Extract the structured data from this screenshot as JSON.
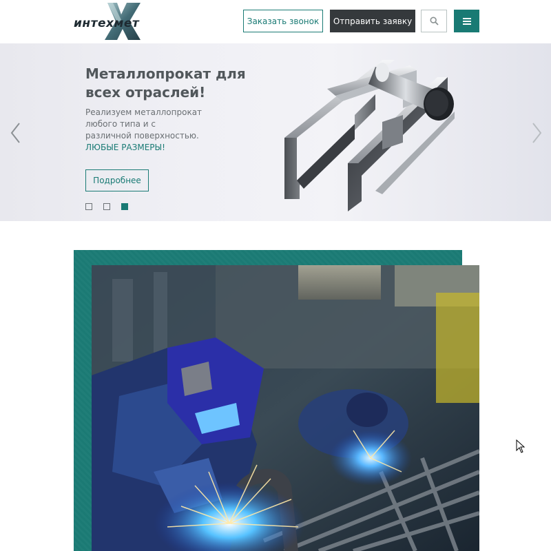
{
  "header": {
    "logo_text": "интехмет",
    "call_button": "Заказать звонок",
    "apply_button": "Отправить заявку",
    "search_icon": "search-icon",
    "menu_icon": "menu-icon"
  },
  "hero": {
    "title": "Металлопрокат для всех отраслей!",
    "text": "Реализуем металлопрокат любого типа и с различной поверхностью.",
    "accent": "ЛЮБЫЕ РАЗМЕРЫ!",
    "more_button": "Подробнее",
    "active_slide": 3,
    "slide_count": 3
  },
  "colors": {
    "accent": "#197a74",
    "dark": "#35393c"
  }
}
